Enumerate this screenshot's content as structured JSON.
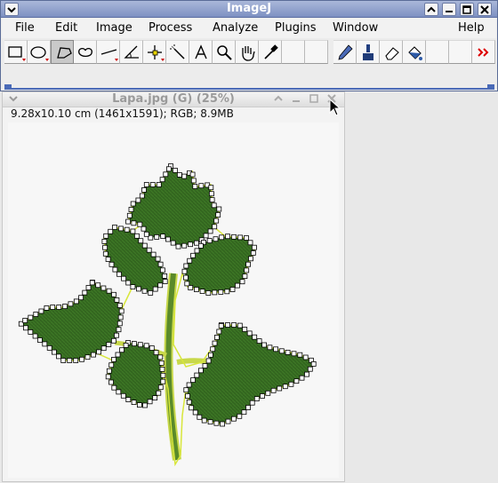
{
  "main_window": {
    "title": "ImageJ",
    "menu": [
      "File",
      "Edit",
      "Image",
      "Process",
      "Analyze",
      "Plugins",
      "Window",
      "Help"
    ],
    "tools": [
      {
        "name": "rectangle-tool-icon",
        "selected": false
      },
      {
        "name": "oval-tool-icon",
        "selected": false
      },
      {
        "name": "polygon-tool-icon",
        "selected": true
      },
      {
        "name": "freehand-tool-icon",
        "selected": false
      },
      {
        "name": "line-tool-icon",
        "selected": false
      },
      {
        "name": "angle-tool-icon",
        "selected": false
      },
      {
        "name": "point-tool-icon",
        "selected": false
      },
      {
        "name": "wand-tool-icon",
        "selected": false
      },
      {
        "name": "text-tool-icon",
        "selected": false
      },
      {
        "name": "magnifier-tool-icon",
        "selected": false
      },
      {
        "name": "hand-tool-icon",
        "selected": false
      },
      {
        "name": "dropper-tool-icon",
        "selected": false
      },
      {
        "name": "empty-slot",
        "selected": false
      },
      {
        "name": "empty-slot",
        "selected": false
      },
      {
        "name": "pencil-tool-icon",
        "selected": false
      },
      {
        "name": "brush-tool-icon",
        "selected": false
      },
      {
        "name": "eraser-tool-icon",
        "selected": false
      },
      {
        "name": "flood-fill-tool-icon",
        "selected": false
      },
      {
        "name": "empty-slot",
        "selected": false
      },
      {
        "name": "empty-slot",
        "selected": false
      },
      {
        "name": "more-tools-icon",
        "selected": false
      }
    ]
  },
  "image_window": {
    "title": "Lapa.jpg (G) (25%)",
    "info": "9.28x10.10 cm (1461x1591); RGB; 8.9MB"
  },
  "colors": {
    "title_active": "#8497c6",
    "toolbar_bg": "#f6f6f6",
    "leaf_green": "#2f5e1e",
    "selection_yellow": "#d8e63a",
    "status_blue": "#4a6ab7"
  }
}
